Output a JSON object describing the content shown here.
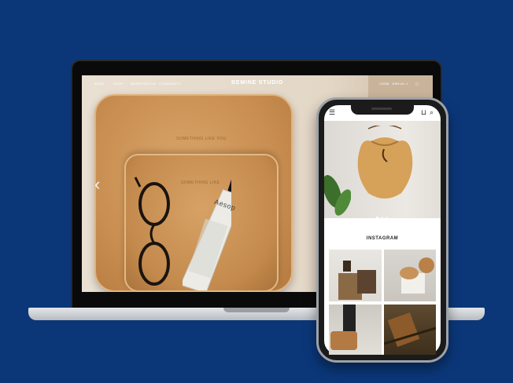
{
  "laptop": {
    "nav": [
      {
        "label": "BAGS"
      },
      {
        "label": "SHOP"
      },
      {
        "label": "RESERVATION"
      },
      {
        "label": "COMMUNITY"
      }
    ],
    "brand": "BEMINE STUDIO",
    "right": {
      "login": "LOGIN",
      "join": "JOIN US"
    },
    "emboss_top": "SOMETHING LIKE YOU",
    "emboss_bottom": "SOMETHING LIKE",
    "tube_brand": "Aesop",
    "prev_arrow": "‹"
  },
  "phone": {
    "menu_icon": "menu-icon",
    "bag_icon": "shopping-bag-icon",
    "search_icon": "search-icon",
    "carousel": {
      "slides": 3,
      "active": 1
    },
    "section_title": "INSTAGRAM"
  },
  "colors": {
    "background": "#0b3779",
    "leather": "#c98e51"
  }
}
